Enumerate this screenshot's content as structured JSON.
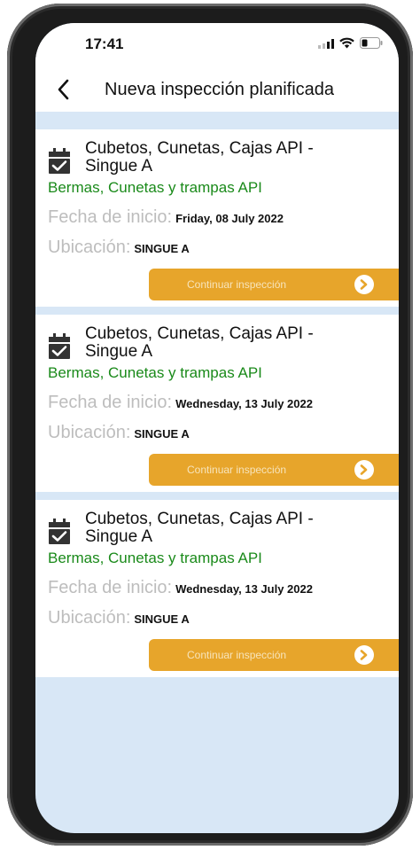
{
  "status_bar": {
    "time": "17:41",
    "icons": [
      "signal-icon",
      "wifi-icon",
      "battery-icon"
    ]
  },
  "nav": {
    "back_icon": "chevron-left-icon",
    "title": "Nueva inspección planificada"
  },
  "colors": {
    "background": "#d8e7f6",
    "card": "#ffffff",
    "category": "#1a8a1a",
    "label_gray": "#bdbdbd",
    "button": "#e7a52b"
  },
  "inspections": [
    {
      "title": "Cubetos, Cunetas, Cajas API - Singue A",
      "category": "Bermas, Cunetas y trampas API",
      "start_label": "Fecha de inicio:",
      "start_date": "Friday, 08 July 2022",
      "location_label": "Ubicación:",
      "location": "SINGUE A",
      "button_label": "Continuar inspección",
      "icon": "calendar-check-icon"
    },
    {
      "title": "Cubetos, Cunetas, Cajas API - Singue A",
      "category": "Bermas, Cunetas y trampas API",
      "start_label": "Fecha de inicio:",
      "start_date": "Wednesday, 13 July 2022",
      "location_label": "Ubicación:",
      "location": "SINGUE A",
      "button_label": "Continuar inspección",
      "icon": "calendar-check-icon"
    },
    {
      "title": "Cubetos, Cunetas, Cajas API - Singue A",
      "category": "Bermas, Cunetas y trampas API",
      "start_label": "Fecha de inicio:",
      "start_date": "Wednesday, 13 July 2022",
      "location_label": "Ubicación:",
      "location": "SINGUE A",
      "button_label": "Continuar inspección",
      "icon": "calendar-check-icon"
    }
  ]
}
